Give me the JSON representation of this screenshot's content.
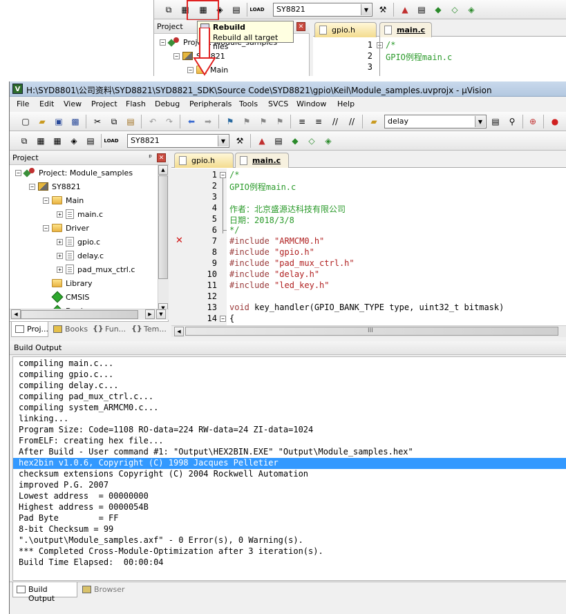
{
  "inset": {
    "target_combo": "SY8821",
    "tooltip_title": "Rebuild",
    "tooltip_desc": "Rebuild all target files",
    "panel_title": "Project",
    "tree": [
      {
        "label": "Project: Module_samples"
      },
      {
        "label": "SY8821"
      },
      {
        "label": "Main"
      }
    ],
    "tabs": [
      {
        "label": "gpio.h"
      },
      {
        "label": "main.c"
      }
    ],
    "code": [
      {
        "n": "1",
        "text": "/*"
      },
      {
        "n": "2",
        "text": "GPIO例程main.c"
      },
      {
        "n": "3",
        "text": ""
      }
    ]
  },
  "window": {
    "title": "H:\\SYD8801\\公司资料\\SYD8821\\SYD8821_SDK\\Source Code\\SYD8821\\gpio\\Keil\\Module_samples.uvprojx - µVision"
  },
  "menu": [
    "File",
    "Edit",
    "View",
    "Project",
    "Flash",
    "Debug",
    "Peripherals",
    "Tools",
    "SVCS",
    "Window",
    "Help"
  ],
  "toolbar": {
    "find_combo": "delay",
    "target_combo": "SY8821"
  },
  "project_panel": {
    "title": "Project",
    "pin": "ᵖ",
    "close": "✕",
    "tree": [
      {
        "label": "Project: Module_samples",
        "kind": "project",
        "indent": 0,
        "exp": "−"
      },
      {
        "label": "SY8821",
        "kind": "target",
        "indent": 1,
        "exp": "−"
      },
      {
        "label": "Main",
        "kind": "folder",
        "indent": 2,
        "exp": "−"
      },
      {
        "label": "main.c",
        "kind": "file",
        "indent": 3,
        "exp": "+"
      },
      {
        "label": "Driver",
        "kind": "folder",
        "indent": 2,
        "exp": "−"
      },
      {
        "label": "gpio.c",
        "kind": "file",
        "indent": 3,
        "exp": "+"
      },
      {
        "label": "delay.c",
        "kind": "file",
        "indent": 3,
        "exp": "+"
      },
      {
        "label": "pad_mux_ctrl.c",
        "kind": "file",
        "indent": 3,
        "exp": "+"
      },
      {
        "label": "Library",
        "kind": "folder",
        "indent": 2,
        "exp": ""
      },
      {
        "label": "CMSIS",
        "kind": "diamond",
        "indent": 2,
        "exp": ""
      },
      {
        "label": "Device",
        "kind": "diamond",
        "indent": 2,
        "exp": ""
      }
    ],
    "bottom_tabs": [
      {
        "label": "Proj..."
      },
      {
        "label": "Books"
      },
      {
        "label": "Fun..."
      },
      {
        "label": "Tem..."
      }
    ]
  },
  "editor": {
    "tabs": [
      {
        "label": "gpio.h",
        "active": false
      },
      {
        "label": "main.c",
        "active": true
      }
    ],
    "lines": [
      {
        "n": "1",
        "fold": "−",
        "parts": [
          {
            "c": "c-cmt",
            "t": "/*"
          }
        ]
      },
      {
        "n": "2",
        "fold": "",
        "parts": [
          {
            "c": "c-cmt",
            "t": "GPIO例程main.c"
          }
        ]
      },
      {
        "n": "3",
        "fold": "",
        "parts": []
      },
      {
        "n": "4",
        "fold": "",
        "parts": [
          {
            "c": "c-cmt",
            "t": "作者：北京盛源达科技有限公司"
          }
        ]
      },
      {
        "n": "5",
        "fold": "",
        "parts": [
          {
            "c": "c-cmt",
            "t": "日期：2018/3/8"
          }
        ]
      },
      {
        "n": "6",
        "fold": "end",
        "parts": [
          {
            "c": "c-cmt",
            "t": "*/"
          }
        ]
      },
      {
        "n": "7",
        "fold": "",
        "err": true,
        "parts": [
          {
            "c": "c-kw",
            "t": "#include "
          },
          {
            "c": "c-str",
            "t": "\"ARMCM0.h\""
          }
        ]
      },
      {
        "n": "8",
        "fold": "",
        "parts": [
          {
            "c": "c-kw",
            "t": "#include "
          },
          {
            "c": "c-str",
            "t": "\"gpio.h\""
          }
        ]
      },
      {
        "n": "9",
        "fold": "",
        "parts": [
          {
            "c": "c-kw",
            "t": "#include "
          },
          {
            "c": "c-str",
            "t": "\"pad_mux_ctrl.h\""
          }
        ]
      },
      {
        "n": "10",
        "fold": "",
        "parts": [
          {
            "c": "c-kw",
            "t": "#include "
          },
          {
            "c": "c-str",
            "t": "\"delay.h\""
          }
        ]
      },
      {
        "n": "11",
        "fold": "",
        "parts": [
          {
            "c": "c-kw",
            "t": "#include "
          },
          {
            "c": "c-str",
            "t": "\"led_key.h\""
          }
        ]
      },
      {
        "n": "12",
        "fold": "",
        "parts": []
      },
      {
        "n": "13",
        "fold": "",
        "parts": [
          {
            "c": "c-kw",
            "t": "void "
          },
          {
            "c": "c-plain",
            "t": "key_handler(GPIO_BANK_TYPE type, uint32_t bitmask)"
          }
        ]
      },
      {
        "n": "14",
        "fold": "−",
        "parts": [
          {
            "c": "c-plain",
            "t": "{"
          }
        ]
      }
    ],
    "hscroll_grip": "III"
  },
  "build_output": {
    "title": "Build Output",
    "lines": [
      {
        "t": "compiling main.c...",
        "sel": false
      },
      {
        "t": "compiling gpio.c...",
        "sel": false
      },
      {
        "t": "compiling delay.c...",
        "sel": false
      },
      {
        "t": "compiling pad_mux_ctrl.c...",
        "sel": false
      },
      {
        "t": "compiling system_ARMCM0.c...",
        "sel": false
      },
      {
        "t": "linking...",
        "sel": false
      },
      {
        "t": "Program Size: Code=1108 RO-data=224 RW-data=24 ZI-data=1024",
        "sel": false
      },
      {
        "t": "FromELF: creating hex file...",
        "sel": false
      },
      {
        "t": "After Build - User command #1: \"Output\\HEX2BIN.EXE\" \"Output\\Module_samples.hex\"",
        "sel": false
      },
      {
        "t": "hex2bin v1.0.6, Copyright (C) 1998 Jacques Pelletier",
        "sel": true
      },
      {
        "t": "checksum extensions Copyright (C) 2004 Rockwell Automation",
        "sel": false
      },
      {
        "t": "improved P.G. 2007",
        "sel": false
      },
      {
        "t": "Lowest address  = 00000000",
        "sel": false
      },
      {
        "t": "Highest address = 0000054B",
        "sel": false
      },
      {
        "t": "Pad Byte        = FF",
        "sel": false
      },
      {
        "t": "8-bit Checksum = 99",
        "sel": false
      },
      {
        "t": "\".\\output\\Module_samples.axf\" - 0 Error(s), 0 Warning(s).",
        "sel": false
      },
      {
        "t": "*** Completed Cross-Module-Optimization after 3 iteration(s).",
        "sel": false
      },
      {
        "t": "Build Time Elapsed:  00:00:04",
        "sel": false
      }
    ],
    "tabs": [
      {
        "label": "Build Output"
      },
      {
        "label": "Browser"
      }
    ]
  },
  "colors": {
    "highlight_box": "#e02020",
    "arrow": "#e02020",
    "selection": "#3399ff",
    "comment": "#2a9a2a",
    "keyword": "#9a3a3a",
    "string": "#b02020",
    "error_marker": "#d01010"
  }
}
